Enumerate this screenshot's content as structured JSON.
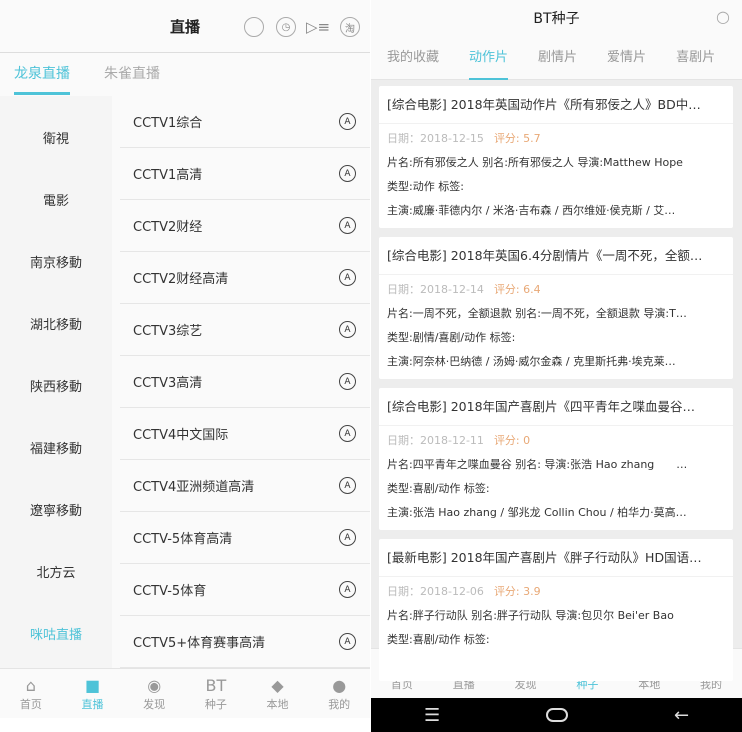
{
  "left": {
    "title": "直播",
    "header_icons": [
      "search-icon",
      "history-icon",
      "playlist-icon",
      "taobao-icon"
    ],
    "taobao_label": "淘",
    "tabs": [
      "龙泉直播",
      "朱雀直播"
    ],
    "categories": [
      "衛視",
      "電影",
      "南京移動",
      "湖北移動",
      "陕西移動",
      "福建移動",
      "遼寧移動",
      "北方云",
      "咪咕直播"
    ],
    "channels": [
      "CCTV1综合",
      "CCTV1高清",
      "CCTV2财经",
      "CCTV2财经高清",
      "CCTV3综艺",
      "CCTV3高清",
      "CCTV4中文国际",
      "CCTV4亚洲频道高清",
      "CCTV-5体育高清",
      "CCTV-5体育",
      "CCTV5+体育赛事高清"
    ],
    "channel_icon": "A"
  },
  "right": {
    "title": "BT种子",
    "tabs": [
      "我的收藏",
      "动作片",
      "剧情片",
      "爱情片",
      "喜剧片"
    ],
    "cards": [
      {
        "title": "[综合电影] 2018年英国动作片《所有邪佞之人》BD中…",
        "date": "日期：2018-12-15",
        "score": "评分: 5.7",
        "name": "片名:所有邪佞之人 别名:所有邪佞之人 导演:Matthew Hope",
        "type": "类型:动作 标签:",
        "cast": "主演:威廉·菲德内尔 / 米洛·吉布森 / 西尔维娅·侯克斯 / 艾…"
      },
      {
        "title": "[综合电影] 2018年英国6.4分剧情片《一周不死，全额…",
        "date": "日期：2018-12-14",
        "score": "评分: 6.4",
        "name": "片名:一周不死，全额退款 别名:一周不死，全额退款 导演:T…",
        "type": "类型:剧情/喜剧/动作 标签:",
        "cast": "主演:阿奈林·巴纳德 / 汤姆·威尔金森 / 克里斯托弗·埃克莱…"
      },
      {
        "title": "[综合电影] 2018年国产喜剧片《四平青年之喋血曼谷…",
        "date": "日期：2018-12-11",
        "score": "评分: 0",
        "name": "片名:四平青年之喋血曼谷 别名: 导演:张浩 Hao zhang　　…",
        "type": "类型:喜剧/动作 标签:",
        "cast": "主演:张浩 Hao zhang / 邹兆龙 Collin Chou / 柏华力·莫高…"
      },
      {
        "title": "[最新电影] 2018年国产喜剧片《胖子行动队》HD国语…",
        "date": "日期：2018-12-06",
        "score": "评分: 3.9",
        "name": "片名:胖子行动队 别名:胖子行动队 导演:包贝尔 Bei'er Bao",
        "type": "类型:喜剧/动作 标签:",
        "cast": ""
      }
    ]
  },
  "nav": [
    {
      "label": "首页",
      "icon": "home-icon",
      "glyph": "⌂"
    },
    {
      "label": "直播",
      "icon": "video-icon",
      "glyph": "■"
    },
    {
      "label": "发现",
      "icon": "eye-icon",
      "glyph": "◉"
    },
    {
      "label": "种子",
      "icon": "bt-icon",
      "glyph": "BT"
    },
    {
      "label": "本地",
      "icon": "box-icon",
      "glyph": "◆"
    },
    {
      "label": "我的",
      "icon": "user-icon",
      "glyph": "●"
    }
  ],
  "colors": {
    "accent": "#4ec3d8",
    "score": "#e8a876"
  }
}
